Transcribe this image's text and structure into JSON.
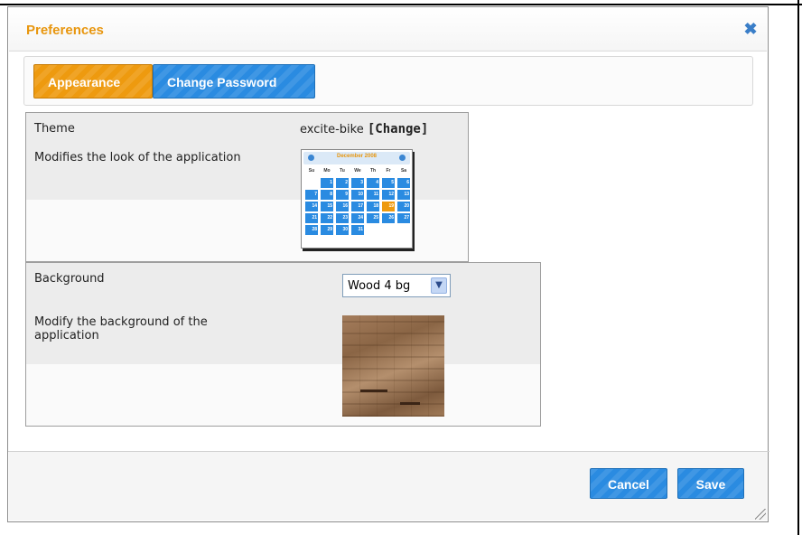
{
  "dialog": {
    "title": "Preferences",
    "close_icon": "close-icon"
  },
  "tabs": [
    {
      "label": "Appearance",
      "active": true
    },
    {
      "label": "Change Password",
      "active": false
    }
  ],
  "theme": {
    "label": "Theme",
    "description": "Modifies the look of the application",
    "value": "excite-bike",
    "change_link": "[Change]",
    "preview": {
      "month_title": "December 2008",
      "weekdays": [
        "Su",
        "Mo",
        "Tu",
        "We",
        "Th",
        "Fr",
        "Sa"
      ],
      "weeks": [
        [
          "",
          "1",
          "2",
          "3",
          "4",
          "5",
          "6"
        ],
        [
          "7",
          "8",
          "9",
          "10",
          "11",
          "12",
          "13"
        ],
        [
          "14",
          "15",
          "16",
          "17",
          "18",
          "19",
          "20"
        ],
        [
          "21",
          "22",
          "23",
          "24",
          "25",
          "26",
          "27"
        ],
        [
          "28",
          "29",
          "30",
          "31",
          "",
          "",
          ""
        ]
      ],
      "highlighted_day": "19"
    }
  },
  "background": {
    "label": "Background",
    "description": "Modify the background of the application",
    "selected_option": "Wood 4 bg"
  },
  "footer": {
    "cancel_label": "Cancel",
    "save_label": "Save"
  },
  "colors": {
    "accent_orange": "#ee9a0f",
    "accent_blue": "#2a8be1",
    "title_orange": "#e8960e"
  }
}
